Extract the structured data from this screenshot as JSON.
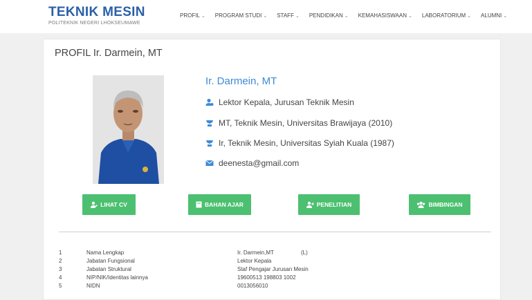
{
  "header": {
    "brand_title": "TEKNIK MESIN",
    "brand_subtitle": "POLITEKNIK NEGERI LHOKSEUMAWE",
    "nav": [
      {
        "label": "PROFIL"
      },
      {
        "label": "PROGRAM STUDI"
      },
      {
        "label": "STAFF"
      },
      {
        "label": "PENDIDIKAN"
      },
      {
        "label": "KEMAHASISWAAN"
      },
      {
        "label": "LABORATORIUM"
      },
      {
        "label": "ALUMNI"
      }
    ]
  },
  "profile": {
    "page_title": "PROFIL Ir. Darmein, MT",
    "name": "Ir. Darmein, MT",
    "position": "Lektor Kepala, Jurusan Teknik Mesin",
    "education_1": "MT, Teknik Mesin, Universitas Brawijaya (2010)",
    "education_2": "Ir, Teknik Mesin, Universitas Syiah Kuala (1987)",
    "email": "deenesta@gmail.com"
  },
  "buttons": {
    "cv": "LIHAT CV",
    "bahan_ajar": "BAHAN AJAR",
    "penelitian": "PENELITIAN",
    "bimbingan": "BIMBINGAN"
  },
  "details": [
    {
      "num": "1",
      "label": "Nama Lengkap",
      "value": "Ir. Darmein,MT",
      "extra": "(L)"
    },
    {
      "num": "2",
      "label": "Jabatan Fungsional",
      "value": "Lektor Kepala",
      "extra": ""
    },
    {
      "num": "3",
      "label": "Jabatan Struktural",
      "value": "Staf Pengajar Jurusan Mesin",
      "extra": ""
    },
    {
      "num": "4",
      "label": "NIP/NIK/Identitas lainnya",
      "value": "19600513 198803 1002",
      "extra": ""
    },
    {
      "num": "5",
      "label": "NIDN",
      "value": "0013056010",
      "extra": ""
    }
  ],
  "colors": {
    "brand": "#2a5fa8",
    "accent": "#3f8ad6",
    "button": "#4cc070"
  }
}
